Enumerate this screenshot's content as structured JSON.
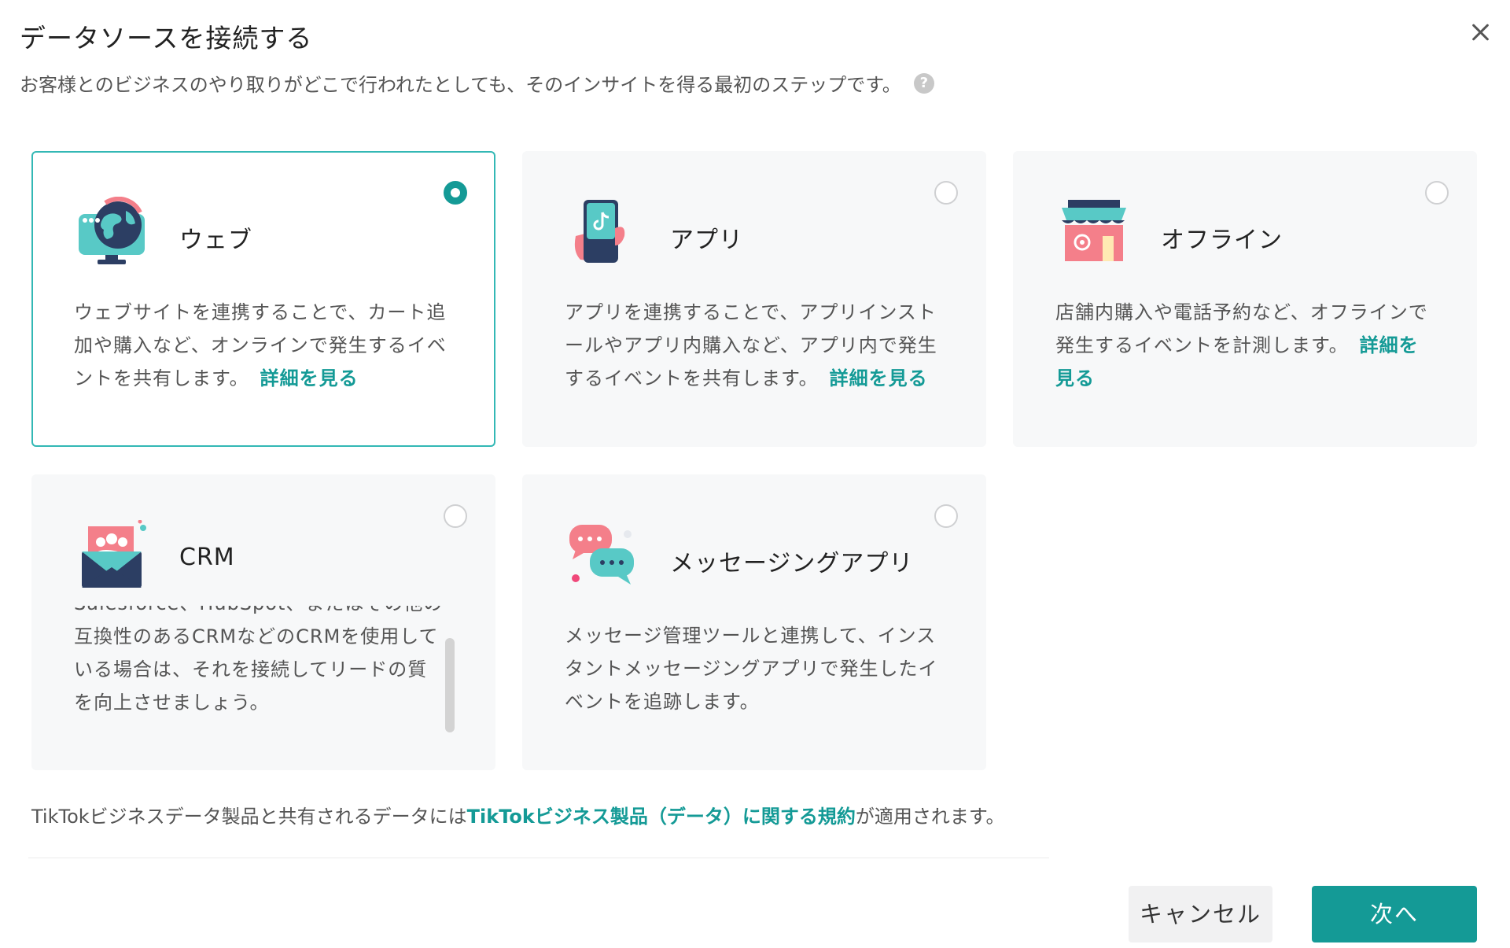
{
  "dialog": {
    "title": "データソースを接続する",
    "subtitle": "お客様とのビジネスのやり取りがどこで行われたとしても、そのインサイトを得る最初のステップです。",
    "help_icon": "question-circle-icon",
    "close_icon": "close-icon"
  },
  "sources": [
    {
      "title": "ウェブ",
      "icon": "web-globe-icon",
      "selected": true,
      "description": "ウェブサイトを連携することで、カート追加や購入など、オンラインで発生するイベントを共有します。",
      "link": "詳細を見る"
    },
    {
      "title": "アプリ",
      "icon": "app-phone-icon",
      "selected": false,
      "description": "アプリを連携することで、アプリインストールやアプリ内購入など、アプリ内で発生するイベントを共有します。",
      "link": "詳細を見る"
    },
    {
      "title": "オフライン",
      "icon": "offline-store-icon",
      "selected": false,
      "description": "店舗内購入や電話予約など、オフラインで発生するイベントを計測します。",
      "link": "詳細を見る"
    },
    {
      "title": "CRM",
      "icon": "crm-envelope-icon",
      "selected": false,
      "description": "Salesforce、HubSpot、またはその他の互換性のあるCRMなどのCRMを使用している場合は、それを接続してリードの質を向上させましょう。",
      "link": ""
    },
    {
      "title": "メッセージングアプリ",
      "icon": "messaging-chat-icon",
      "selected": false,
      "description": "メッセージ管理ツールと連携して、インスタントメッセージングアプリで発生したイベントを追跡します。",
      "link": ""
    }
  ],
  "footer": {
    "note_prefix": "TikTokビジネスデータ製品と共有されるデータには",
    "note_link": "TikTokビジネス製品（データ）に関する規約",
    "note_suffix": "が適用されます。",
    "cancel_label": "キャンセル",
    "next_label": "次へ"
  },
  "colors": {
    "accent": "#149a96",
    "selected_border": "#33b8b5",
    "card_bg": "#f7f8f9"
  }
}
